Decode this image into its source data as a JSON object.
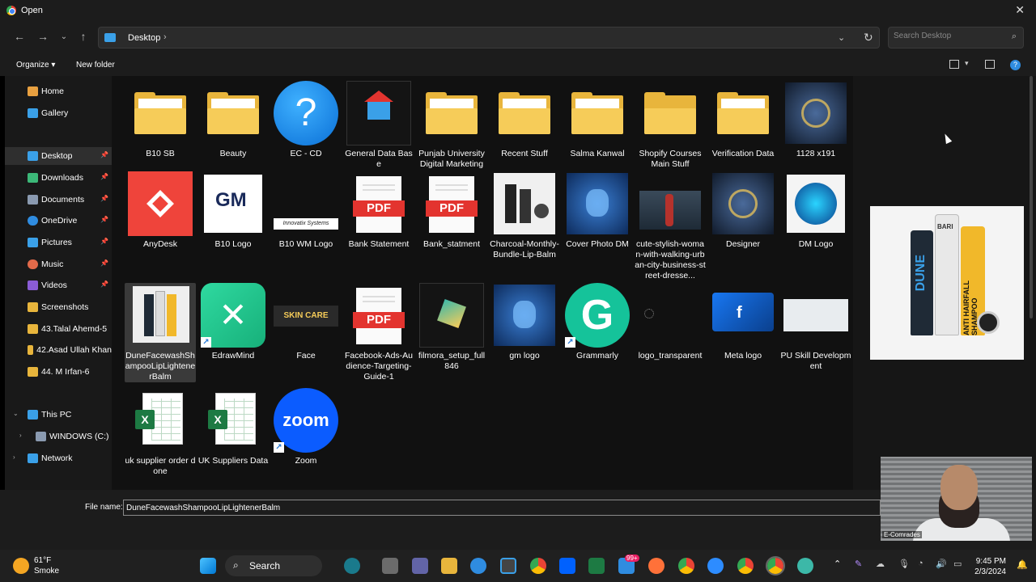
{
  "window": {
    "title": "Open"
  },
  "address": {
    "crumb": "Desktop",
    "separator": "›"
  },
  "search": {
    "placeholder": "Search Desktop"
  },
  "toolbar": {
    "organize": "Organize ▾",
    "new_folder": "New folder"
  },
  "sidebar": {
    "items": [
      {
        "label": "Home",
        "color": "#e8a040"
      },
      {
        "label": "Gallery",
        "color": "#3aa0e8"
      },
      {
        "label": "Desktop",
        "color": "#3aa0e8"
      },
      {
        "label": "Downloads",
        "color": "#3cb878"
      },
      {
        "label": "Documents",
        "color": "#8a9ab0"
      },
      {
        "label": "OneDrive",
        "color": "#2f8ce0"
      },
      {
        "label": "Pictures",
        "color": "#3aa0e8"
      },
      {
        "label": "Music",
        "color": "#e36a4a"
      },
      {
        "label": "Videos",
        "color": "#8a5cd6"
      },
      {
        "label": "Screenshots",
        "color": "#e8b53c"
      },
      {
        "label": "43.Talal Ahemd-5",
        "color": "#e8b53c"
      },
      {
        "label": "42.Asad Ullah Khan",
        "color": "#e8b53c"
      },
      {
        "label": "44. M Irfan-6",
        "color": "#e8b53c"
      },
      {
        "label": "This PC",
        "color": "#3aa0e8"
      },
      {
        "label": "WINDOWS (C:)",
        "color": "#8a9ab0"
      },
      {
        "label": "Network",
        "color": "#3aa0e8"
      }
    ]
  },
  "files": [
    {
      "name": "B10 SB",
      "kind": "folder"
    },
    {
      "name": "Beauty",
      "kind": "folder"
    },
    {
      "name": "EC - CD",
      "kind": "question"
    },
    {
      "name": "General Data Base",
      "kind": "house"
    },
    {
      "name": "Punjab University Digital Marketing",
      "kind": "folder"
    },
    {
      "name": "Recent Stuff",
      "kind": "folder"
    },
    {
      "name": "Salma Kanwal",
      "kind": "folder"
    },
    {
      "name": "Shopify Courses Main Stuff",
      "kind": "folder-plain"
    },
    {
      "name": "Verification Data",
      "kind": "folder"
    },
    {
      "name": "1128 x191",
      "kind": "image-dark"
    },
    {
      "name": "AnyDesk",
      "kind": "anydesk"
    },
    {
      "name": "B10 Logo",
      "kind": "gm"
    },
    {
      "name": "B10 WM Logo",
      "kind": "wm"
    },
    {
      "name": "Bank Statement",
      "kind": "pdf"
    },
    {
      "name": "Bank_statment",
      "kind": "pdf"
    },
    {
      "name": "Charcoal-Monthly-Bundle-Lip-Balm",
      "kind": "image-light"
    },
    {
      "name": "Cover Photo DM",
      "kind": "image-blue"
    },
    {
      "name": "cute-stylish-woman-with-walking-urban-city-business-street-dresse...",
      "kind": "image-street"
    },
    {
      "name": "Designer",
      "kind": "image-dark"
    },
    {
      "name": "DM Logo",
      "kind": "image-restart"
    },
    {
      "name": "DuneFacewashShampooLipLightenerBalm",
      "kind": "image-dune"
    },
    {
      "name": "EdrawMind",
      "kind": "edraw"
    },
    {
      "name": "Face",
      "kind": "face"
    },
    {
      "name": "Facebook-Ads-Audience-Targeting-Guide-1",
      "kind": "pdf"
    },
    {
      "name": "filmora_setup_full846",
      "kind": "filmora"
    },
    {
      "name": "gm logo",
      "kind": "image-blue"
    },
    {
      "name": "Grammarly",
      "kind": "grammarly"
    },
    {
      "name": "logo_transparent",
      "kind": "blank"
    },
    {
      "name": "Meta logo",
      "kind": "meta"
    },
    {
      "name": "PU Skill Development",
      "kind": "map"
    },
    {
      "name": "uk supplier order done",
      "kind": "xls"
    },
    {
      "name": "UK Suppliers Data",
      "kind": "xls"
    },
    {
      "name": "Zoom",
      "kind": "zoom"
    }
  ],
  "file_name": {
    "label": "File name:",
    "value": "DuneFacewashShampooLipLightenerBalm"
  },
  "preview": {
    "line1": "DUNE",
    "line2": "ANTI HAIRFALL SHAMPOO",
    "brand": "BARI"
  },
  "gm_text": "GM",
  "wm_text": "Innovatix Systems",
  "pdf_label": "PDF",
  "zoom_label": "zoom",
  "face_label": "SKIN CARE",
  "webcam_caption": "E-Comrades",
  "taskbar": {
    "weather_temp": "61°F",
    "weather_desc": "Smoke",
    "search_label": "Search",
    "time": "9:45 PM",
    "date": "2/3/2024",
    "badge": "99+"
  }
}
